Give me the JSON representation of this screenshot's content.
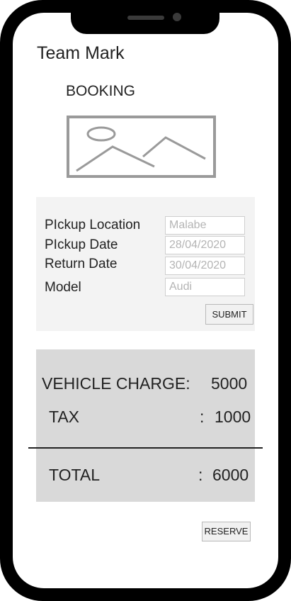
{
  "header": {
    "app_title": "Team Mark",
    "page_heading": "BOOKING"
  },
  "hero": {
    "icon": "image-placeholder-icon"
  },
  "form": {
    "fields": [
      {
        "label": "PIckup Location",
        "value": "Malabe"
      },
      {
        "label": "PIckup Date",
        "value": "28/04/2020"
      },
      {
        "label": "Return Date",
        "value": "30/04/2020"
      },
      {
        "label": "Model",
        "value": "Audi"
      }
    ],
    "submit_label": "SUBMIT"
  },
  "summary": {
    "vehicle_charge_label": "VEHICLE CHARGE:",
    "vehicle_charge_value": "5000",
    "tax_label": "TAX",
    "tax_separator": ":",
    "tax_value": "1000",
    "total_label": "TOTAL",
    "total_separator": ":",
    "total_value": "6000"
  },
  "actions": {
    "reserve_label": "RESERVE"
  },
  "colors": {
    "frame": "#000000",
    "screen": "#ffffff",
    "form_panel": "#f3f3f3",
    "summary_panel": "#d9d9d9",
    "placeholder_text": "#b4b4b4",
    "image_stroke": "#9a9a9a"
  }
}
